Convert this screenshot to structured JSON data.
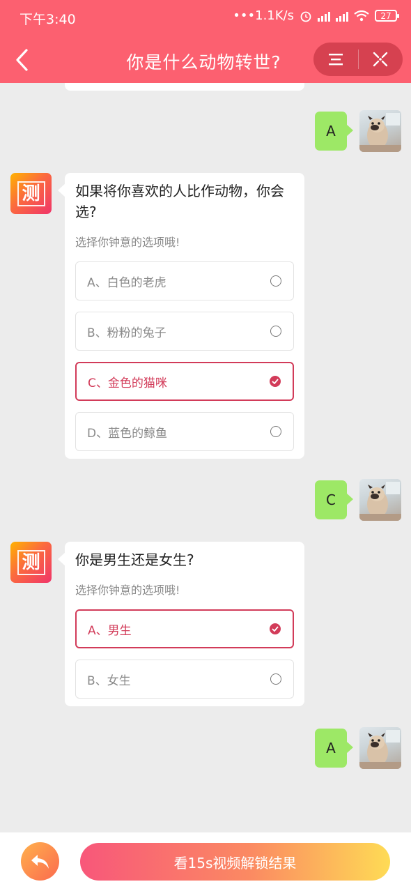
{
  "status_bar": {
    "time": "下午3:40",
    "network_speed": "•••1.1K/s",
    "battery": "27"
  },
  "header": {
    "title": "你是什么动物转世?",
    "back_icon": "chevron-left-icon",
    "menu_icon": "menu-icon",
    "close_icon": "close-icon",
    "bar_color": "#fc6070"
  },
  "conversation": {
    "replies": [
      "A",
      "C",
      "A"
    ],
    "bot_avatar_char": "测",
    "questions": [
      {
        "text": "如果将你喜欢的人比作动物，你会选?",
        "hint": "选择你钟意的选项哦!",
        "options": [
          {
            "label": "A、白色的老虎",
            "selected": false
          },
          {
            "label": "B、粉粉的兔子",
            "selected": false
          },
          {
            "label": "C、金色的猫咪",
            "selected": true
          },
          {
            "label": "D、蓝色的鲸鱼",
            "selected": false
          }
        ]
      },
      {
        "text": "你是男生还是女生?",
        "hint": "选择你钟意的选项哦!",
        "options": [
          {
            "label": "A、男生",
            "selected": true
          },
          {
            "label": "B、女生",
            "selected": false
          }
        ]
      }
    ]
  },
  "footer": {
    "undo_icon": "undo-icon",
    "unlock_label": "看15s视频解锁结果"
  },
  "colors": {
    "accent": "#d23b59",
    "reply_bubble": "#9de866",
    "background": "#ececec"
  }
}
